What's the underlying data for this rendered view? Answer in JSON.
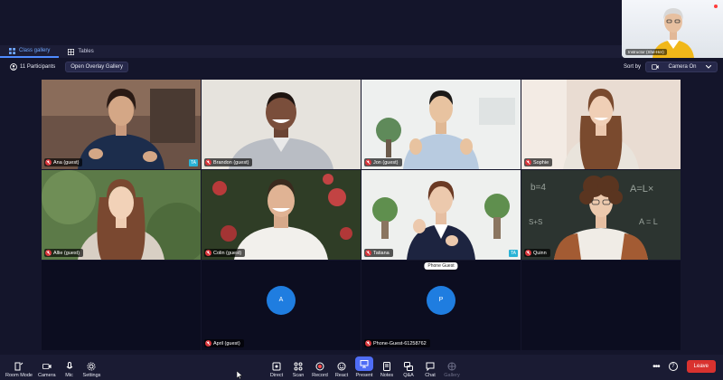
{
  "tabs": [
    {
      "label": "Class gallery",
      "icon": "grid-icon",
      "active": true
    },
    {
      "label": "Tables",
      "icon": "table-icon",
      "active": false
    }
  ],
  "self_view": {
    "name": "Instructor (She-Her)"
  },
  "subbar": {
    "participants": "11 Participants",
    "overlay_button": "Open Overlay Gallery",
    "sort_label": "Sort by",
    "sort_value": "Camera On"
  },
  "tiles": [
    {
      "name": "Ana (guest)",
      "ta": "TA"
    },
    {
      "name": "Brandon (guest)"
    },
    {
      "name": "Jon (guest)"
    },
    {
      "name": "Sophie"
    },
    {
      "name": "Allie (guest)"
    },
    {
      "name": "Colin (guest)"
    },
    {
      "name": "Tatiana",
      "ta": "TA",
      "tooltip": "Phone Guest"
    },
    {
      "name": "Quinn"
    },
    {
      "name": "April (guest)",
      "avatar": "A"
    },
    {
      "name": "Phone-Guest-61258762",
      "avatar": "P"
    }
  ],
  "toolbar": {
    "left": [
      {
        "label": "Room Mode",
        "icon": "room-mode-icon"
      },
      {
        "label": "Camera",
        "icon": "camera-icon"
      },
      {
        "label": "Mic",
        "icon": "mic-icon"
      },
      {
        "label": "Settings",
        "icon": "settings-icon"
      }
    ],
    "center": [
      {
        "label": "Direct",
        "icon": "direct-icon"
      },
      {
        "label": "Scan",
        "icon": "scan-icon"
      },
      {
        "label": "Record",
        "icon": "record-icon"
      },
      {
        "label": "React",
        "icon": "react-icon"
      },
      {
        "label": "Present",
        "icon": "present-icon"
      },
      {
        "label": "Notes",
        "icon": "notes-icon"
      },
      {
        "label": "Q&A",
        "icon": "qa-icon"
      },
      {
        "label": "Chat",
        "icon": "chat-icon"
      },
      {
        "label": "Gallery",
        "icon": "gallery-icon"
      }
    ],
    "leave": "Leave",
    "more": "•••",
    "help": "?"
  },
  "colors": {
    "background": "#14152b",
    "accent": "#4f6df5",
    "leave": "#d9322f",
    "mute": "#d8353b",
    "avatar": "#1f7de0"
  }
}
